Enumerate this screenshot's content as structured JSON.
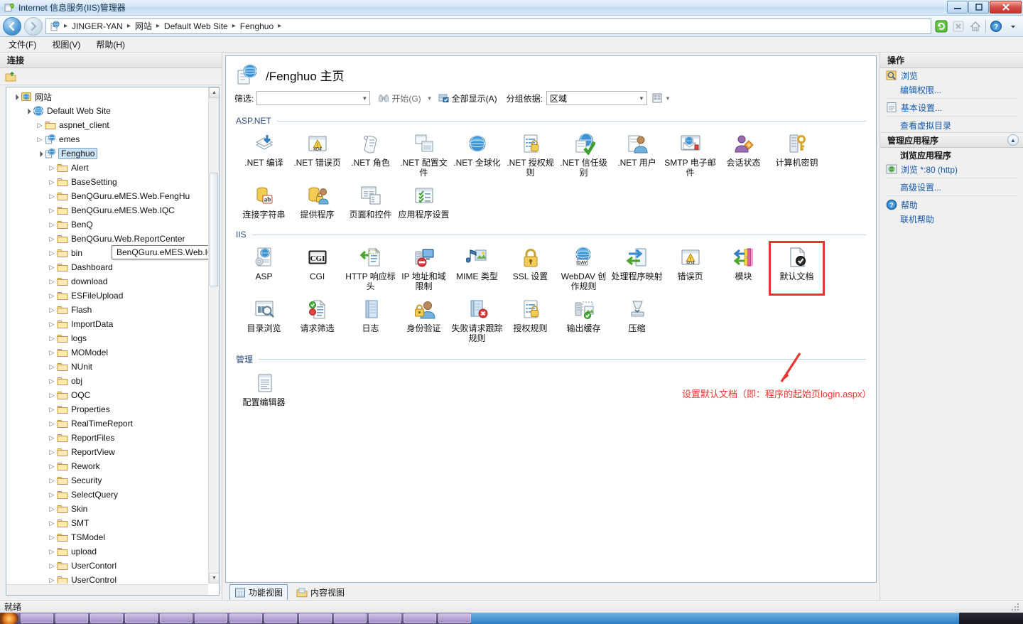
{
  "window": {
    "title": "Internet 信息服务(IIS)管理器",
    "minimize_label": "—",
    "maximize_label": "❐",
    "close_label": "✕"
  },
  "addressbar": {
    "back_label": "◀",
    "forward_label": "▶",
    "crumbs": [
      "JINGER-YAN",
      "网站",
      "Default Web Site",
      "Fenghuo"
    ],
    "separator": "▸",
    "icons": [
      "refresh-icon",
      "stop-icon",
      "home-icon",
      "help-icon",
      "dropdown-icon"
    ]
  },
  "menubar": {
    "items": [
      "文件(F)",
      "视图(V)",
      "帮助(H)"
    ]
  },
  "connections": {
    "header": "连接",
    "tree": [
      {
        "label": "网站",
        "depth": 0,
        "expander": "▲",
        "icon": "sites-icon",
        "selected": false
      },
      {
        "label": "Default Web Site",
        "depth": 1,
        "expander": "▲",
        "icon": "site-icon",
        "selected": false
      },
      {
        "label": "aspnet_client",
        "depth": 2,
        "expander": "▷",
        "icon": "folder-icon",
        "selected": false
      },
      {
        "label": "emes",
        "depth": 2,
        "expander": "▷",
        "icon": "app-icon",
        "selected": false
      },
      {
        "label": "Fenghuo",
        "depth": 2,
        "expander": "▲",
        "icon": "app-icon",
        "selected": true
      },
      {
        "label": "Alert",
        "depth": 3,
        "expander": "▷",
        "icon": "folder-icon",
        "selected": false
      },
      {
        "label": "BaseSetting",
        "depth": 3,
        "expander": "▷",
        "icon": "folder-icon",
        "selected": false
      },
      {
        "label": "BenQGuru.eMES.Web.FengHu",
        "depth": 3,
        "expander": "▷",
        "icon": "folder-icon",
        "selected": false
      },
      {
        "label": "BenQGuru.eMES.Web.IQC",
        "depth": 3,
        "expander": "▷",
        "icon": "folder-icon",
        "selected": false
      },
      {
        "label": "BenQ",
        "depth": 3,
        "expander": "▷",
        "icon": "folder-icon",
        "selected": false
      },
      {
        "label": "BenQGuru.Web.ReportCenter",
        "depth": 3,
        "expander": "▷",
        "icon": "folder-icon",
        "selected": false
      },
      {
        "label": "bin",
        "depth": 3,
        "expander": "▷",
        "icon": "folder-icon",
        "selected": false
      },
      {
        "label": "Dashboard",
        "depth": 3,
        "expander": "▷",
        "icon": "folder-icon",
        "selected": false
      },
      {
        "label": "download",
        "depth": 3,
        "expander": "▷",
        "icon": "folder-icon",
        "selected": false
      },
      {
        "label": "ESFileUpload",
        "depth": 3,
        "expander": "▷",
        "icon": "folder-icon",
        "selected": false
      },
      {
        "label": "Flash",
        "depth": 3,
        "expander": "▷",
        "icon": "folder-icon",
        "selected": false
      },
      {
        "label": "ImportData",
        "depth": 3,
        "expander": "▷",
        "icon": "folder-icon",
        "selected": false
      },
      {
        "label": "logs",
        "depth": 3,
        "expander": "▷",
        "icon": "folder-icon",
        "selected": false
      },
      {
        "label": "MOModel",
        "depth": 3,
        "expander": "▷",
        "icon": "folder-icon",
        "selected": false
      },
      {
        "label": "NUnit",
        "depth": 3,
        "expander": "▷",
        "icon": "folder-icon",
        "selected": false
      },
      {
        "label": "obj",
        "depth": 3,
        "expander": "▷",
        "icon": "folder-icon",
        "selected": false
      },
      {
        "label": "OQC",
        "depth": 3,
        "expander": "▷",
        "icon": "folder-icon",
        "selected": false
      },
      {
        "label": "Properties",
        "depth": 3,
        "expander": "▷",
        "icon": "folder-icon",
        "selected": false
      },
      {
        "label": "RealTimeReport",
        "depth": 3,
        "expander": "▷",
        "icon": "folder-icon",
        "selected": false
      },
      {
        "label": "ReportFiles",
        "depth": 3,
        "expander": "▷",
        "icon": "folder-icon",
        "selected": false
      },
      {
        "label": "ReportView",
        "depth": 3,
        "expander": "▷",
        "icon": "folder-icon",
        "selected": false
      },
      {
        "label": "Rework",
        "depth": 3,
        "expander": "▷",
        "icon": "folder-icon",
        "selected": false
      },
      {
        "label": "Security",
        "depth": 3,
        "expander": "▷",
        "icon": "folder-icon",
        "selected": false
      },
      {
        "label": "SelectQuery",
        "depth": 3,
        "expander": "▷",
        "icon": "folder-icon",
        "selected": false
      },
      {
        "label": "Skin",
        "depth": 3,
        "expander": "▷",
        "icon": "folder-icon",
        "selected": false
      },
      {
        "label": "SMT",
        "depth": 3,
        "expander": "▷",
        "icon": "folder-icon",
        "selected": false
      },
      {
        "label": "TSModel",
        "depth": 3,
        "expander": "▷",
        "icon": "folder-icon",
        "selected": false
      },
      {
        "label": "upload",
        "depth": 3,
        "expander": "▷",
        "icon": "folder-icon",
        "selected": false
      },
      {
        "label": "UserContorl",
        "depth": 3,
        "expander": "▷",
        "icon": "folder-icon",
        "selected": false
      },
      {
        "label": "UserControl",
        "depth": 3,
        "expander": "▷",
        "icon": "folder-icon",
        "selected": false
      }
    ],
    "tooltip": "BenQGuru.eMES.Web.IQC"
  },
  "page": {
    "title": "/Fenghuo 主页",
    "filter": {
      "label": "筛选:",
      "value": "",
      "placeholder": "",
      "start_label": "开始(G)",
      "showall_label": "全部显示(A)",
      "groupby_label": "分组依据:",
      "groupby_value": "区域"
    },
    "groups": [
      {
        "name": "ASP.NET",
        "items": [
          {
            "label": ".NET 编译",
            "icon": "net-compile-icon"
          },
          {
            "label": ".NET 错误页",
            "icon": "net-error-pages-icon"
          },
          {
            "label": ".NET 角色",
            "icon": "net-roles-icon"
          },
          {
            "label": ".NET 配置文件",
            "icon": "net-profile-icon"
          },
          {
            "label": ".NET 全球化",
            "icon": "net-globalization-icon"
          },
          {
            "label": ".NET 授权规则",
            "icon": "net-authorization-icon"
          },
          {
            "label": ".NET 信任级别",
            "icon": "net-trust-levels-icon"
          },
          {
            "label": ".NET 用户",
            "icon": "net-users-icon"
          },
          {
            "label": "SMTP 电子邮件",
            "icon": "smtp-email-icon"
          },
          {
            "label": "会话状态",
            "icon": "session-state-icon"
          },
          {
            "label": "计算机密钥",
            "icon": "machine-key-icon"
          },
          {
            "label": "连接字符串",
            "icon": "connection-strings-icon"
          },
          {
            "label": "提供程序",
            "icon": "providers-icon"
          },
          {
            "label": "页面和控件",
            "icon": "pages-and-controls-icon"
          },
          {
            "label": "应用程序设置",
            "icon": "application-settings-icon"
          }
        ]
      },
      {
        "name": "IIS",
        "items": [
          {
            "label": "ASP",
            "icon": "asp-icon"
          },
          {
            "label": "CGI",
            "icon": "cgi-icon"
          },
          {
            "label": "HTTP 响应标头",
            "icon": "http-response-headers-icon"
          },
          {
            "label": "IP 地址和域限制",
            "icon": "ip-restrictions-icon"
          },
          {
            "label": "MIME 类型",
            "icon": "mime-types-icon"
          },
          {
            "label": "SSL 设置",
            "icon": "ssl-settings-icon"
          },
          {
            "label": "WebDAV 创作规则",
            "icon": "webdav-icon"
          },
          {
            "label": "处理程序映射",
            "icon": "handler-mappings-icon"
          },
          {
            "label": "错误页",
            "icon": "error-pages-icon"
          },
          {
            "label": "模块",
            "icon": "modules-icon"
          },
          {
            "label": "默认文档",
            "icon": "default-document-icon",
            "highlighted": true
          },
          {
            "label": "目录浏览",
            "icon": "directory-browsing-icon"
          },
          {
            "label": "请求筛选",
            "icon": "request-filtering-icon"
          },
          {
            "label": "日志",
            "icon": "logging-icon"
          },
          {
            "label": "身份验证",
            "icon": "authentication-icon"
          },
          {
            "label": "失败请求跟踪规则",
            "icon": "failed-request-tracing-icon"
          },
          {
            "label": "授权规则",
            "icon": "authorization-rules-icon"
          },
          {
            "label": "输出缓存",
            "icon": "output-caching-icon"
          },
          {
            "label": "压缩",
            "icon": "compression-icon"
          }
        ]
      },
      {
        "name": "管理",
        "items": [
          {
            "label": "配置编辑器",
            "icon": "configuration-editor-icon"
          }
        ]
      }
    ],
    "annotation": "设置默认文档（即：程序的起始页login.aspx）",
    "annotation_color": "#e8352f",
    "view_tabs": [
      {
        "label": "功能视图",
        "icon": "features-view-icon",
        "active": true
      },
      {
        "label": "内容视图",
        "icon": "content-view-icon",
        "active": false
      }
    ]
  },
  "actions": {
    "header": "操作",
    "items": [
      {
        "label": "浏览",
        "icon": "browse-icon",
        "bold": false,
        "indent": false
      },
      {
        "label": "编辑权限...",
        "icon": "",
        "bold": false,
        "indent": true
      },
      {
        "label": "基本设置...",
        "icon": "basic-settings-icon",
        "bold": false,
        "indent": false
      },
      {
        "label": "查看虚拟目录",
        "icon": "",
        "bold": false,
        "indent": true
      }
    ],
    "group": {
      "header": "管理应用程序",
      "collapse_icon": "chevron-up-icon",
      "items": [
        {
          "label": "浏览应用程序",
          "icon": "",
          "bold": true,
          "indent": true
        },
        {
          "label": "浏览 *:80 (http)",
          "icon": "browse-site-icon",
          "bold": false,
          "indent": false
        },
        {
          "label": "高级设置...",
          "icon": "",
          "bold": false,
          "indent": true
        },
        {
          "label": "帮助",
          "icon": "help-circle-icon",
          "bold": false,
          "indent": false
        },
        {
          "label": "联机帮助",
          "icon": "",
          "bold": false,
          "indent": true
        }
      ]
    }
  },
  "statusbar": {
    "text": "就绪"
  }
}
